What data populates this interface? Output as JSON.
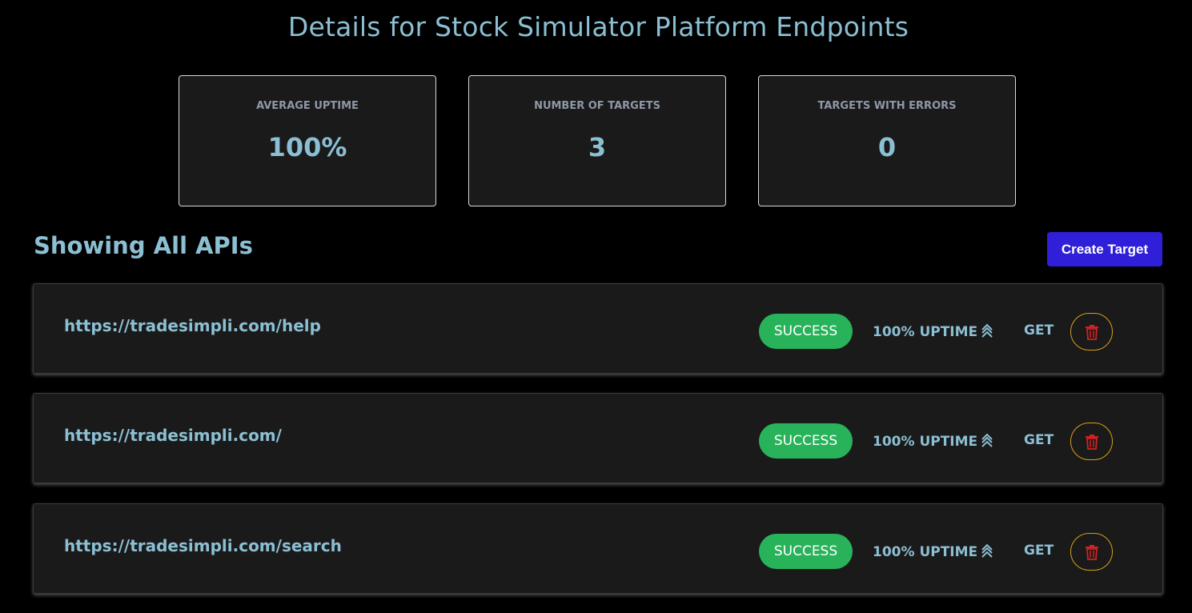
{
  "page": {
    "title": "Details for Stock Simulator Platform Endpoints"
  },
  "stats": [
    {
      "label": "AVERAGE UPTIME",
      "value": "100%"
    },
    {
      "label": "NUMBER OF TARGETS",
      "value": "3"
    },
    {
      "label": "TARGETS WITH ERRORS",
      "value": "0"
    }
  ],
  "section": {
    "heading": "Showing All APIs",
    "create_button_label": "Create Target"
  },
  "apis": [
    {
      "url": "https://tradesimpli.com/help",
      "status": "SUCCESS",
      "uptime": "100% UPTIME",
      "method": "GET"
    },
    {
      "url": "https://tradesimpli.com/",
      "status": "SUCCESS",
      "uptime": "100% UPTIME",
      "method": "GET"
    },
    {
      "url": "https://tradesimpli.com/search",
      "status": "SUCCESS",
      "uptime": "100% UPTIME",
      "method": "GET"
    }
  ],
  "icons": {
    "uptime": "double-chevron-up-icon",
    "delete": "trash-icon"
  },
  "colors": {
    "background": "#000000",
    "card_background": "#1b1a1a",
    "accent_text": "#8bbfd3",
    "stat_label": "#8e98a6",
    "primary_button": "#2f1fd8",
    "success": "#28b35a",
    "delete_border": "#d4a017",
    "delete_icon": "#d42020"
  }
}
